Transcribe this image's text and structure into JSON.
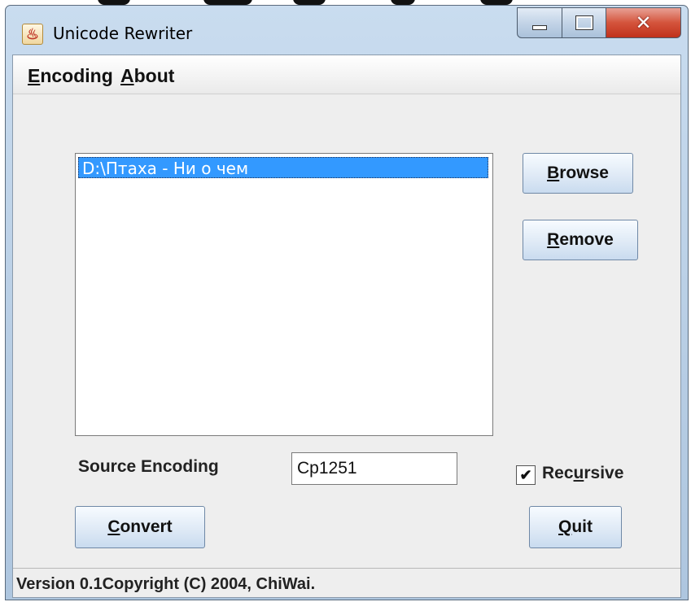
{
  "window": {
    "title": "Unicode Rewriter",
    "icon": "java-cup-icon",
    "caption_buttons": [
      "minimize",
      "maximize",
      "close"
    ]
  },
  "menubar": {
    "items": [
      {
        "label": "Encoding",
        "mnemonic": "E"
      },
      {
        "label": "About",
        "mnemonic": "A"
      }
    ]
  },
  "file_list": {
    "items": [
      "D:\\Птаха - Ни о чем"
    ],
    "selected_index": 0
  },
  "buttons": {
    "browse": {
      "label": "Browse",
      "mnemonic": "B"
    },
    "remove": {
      "label": "Remove",
      "mnemonic": "R"
    },
    "convert": {
      "label": "Convert",
      "mnemonic": "C"
    },
    "quit": {
      "label": "Quit",
      "mnemonic": "Q"
    }
  },
  "source_encoding": {
    "label": "Source Encoding",
    "value": "Cp1251"
  },
  "recursive": {
    "label": "Recursive",
    "mnemonic": "u",
    "checked": true
  },
  "status": {
    "text": "Version 0.1Copyright (C) 2004, ChiWai."
  },
  "colors": {
    "selection": "#3399ff",
    "client_bg": "#eeeeee",
    "close_button": "#c8462b"
  }
}
